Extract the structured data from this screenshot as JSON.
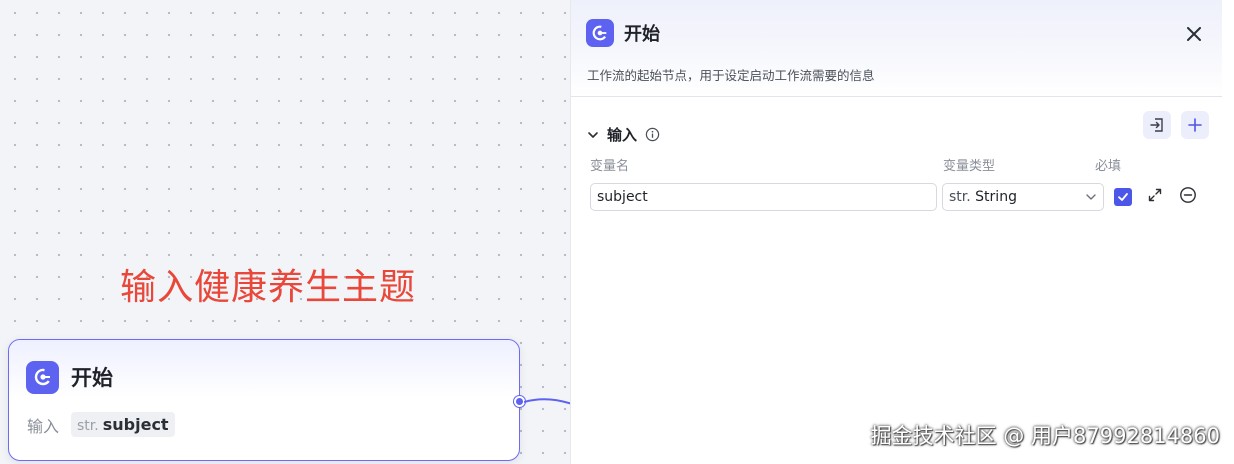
{
  "canvas": {
    "annotation": "输入健康养生主题",
    "node": {
      "title": "开始",
      "input_label": "输入",
      "variable": {
        "type": "str.",
        "name": "subject"
      }
    }
  },
  "panel": {
    "title": "开始",
    "description": "工作流的起始节点，用于设定启动工作流需要的信息",
    "section": {
      "title": "输入"
    },
    "columns": {
      "name": "变量名",
      "type": "变量类型",
      "required": "必填"
    },
    "variables": [
      {
        "name": "subject",
        "type_prefix": "str.",
        "type_label": "String",
        "required": true
      }
    ]
  },
  "watermark": "掘金技术社区 @ 用户87992814860",
  "colors": {
    "accent": "#5d63f0",
    "annotation": "#e8473a",
    "checkbox": "#4c56e8"
  },
  "icons": [
    "start-node-icon",
    "close-icon",
    "chevron-down-icon",
    "info-icon",
    "import-icon",
    "plus-icon",
    "check-icon",
    "expand-icon",
    "remove-circle-icon"
  ]
}
